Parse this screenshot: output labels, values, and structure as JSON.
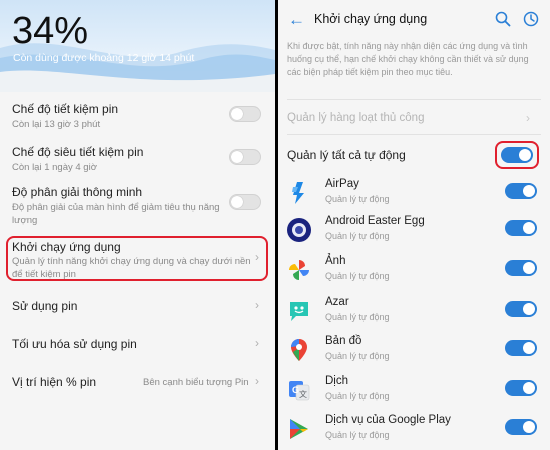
{
  "left": {
    "battery_percent": "34%",
    "remaining": "Còn dùng được khoảng 12 giờ 14 phút",
    "rows": [
      {
        "title": "Chế độ tiết kiệm pin",
        "sub": "Còn lại 13 giờ 3 phút",
        "control": "toggle",
        "on": false
      },
      {
        "title": "Chế độ siêu tiết kiệm pin",
        "sub": "Còn lại 1 ngày 4 giờ",
        "control": "toggle",
        "on": false
      },
      {
        "title": "Độ phân giải thông minh",
        "sub": "Độ phân giải của màn hình để giảm tiêu thụ năng lượng",
        "control": "toggle",
        "on": false
      },
      {
        "title": "Khởi chạy ứng dụng",
        "sub": "Quản lý tính năng khởi chạy ứng dụng và chạy dưới nền để tiết kiệm pin",
        "control": "chevron"
      },
      {
        "title": "Sử dụng pin",
        "control": "chevron"
      },
      {
        "title": "Tối ưu hóa sử dụng pin",
        "control": "chevron"
      },
      {
        "title": "Vị trí hiện % pin",
        "value": "Bên cạnh biểu tượng Pin",
        "control": "chevron"
      }
    ],
    "chevron_glyph": "›"
  },
  "right": {
    "title": "Khởi chạy ứng dụng",
    "back_glyph": "←",
    "description": "Khi được bật, tính năng này nhận diện các ứng dụng và tình huống cụ thể, hạn chế khởi chạy không cần thiết và sử dụng các biện pháp tiết kiệm pin theo mục tiêu.",
    "manual_label": "Quản lý hàng loạt thủ công",
    "auto_label": "Quản lý tất cả tự động",
    "auto_on": true,
    "apps": [
      {
        "name": "AirPay",
        "status": "Quản lý tự động",
        "on": true,
        "icon": "airpay-icon"
      },
      {
        "name": "Android Easter Egg",
        "status": "Quản lý tự động",
        "on": true,
        "icon": "android-easter-egg-icon"
      },
      {
        "name": "Ảnh",
        "status": "Quản lý tự động",
        "on": true,
        "icon": "google-photos-icon"
      },
      {
        "name": "Azar",
        "status": "Quản lý tự động",
        "on": true,
        "icon": "azar-icon"
      },
      {
        "name": "Bản đồ",
        "status": "Quản lý tự động",
        "on": true,
        "icon": "google-maps-icon"
      },
      {
        "name": "Dịch",
        "status": "Quản lý tự động",
        "on": true,
        "icon": "google-translate-icon"
      },
      {
        "name": "Dịch vụ của Google Play",
        "status": "Quản lý tự động",
        "on": true,
        "icon": "google-play-services-icon"
      }
    ]
  },
  "colors": {
    "accent": "#2a7fd6",
    "highlight": "#e0202e"
  }
}
